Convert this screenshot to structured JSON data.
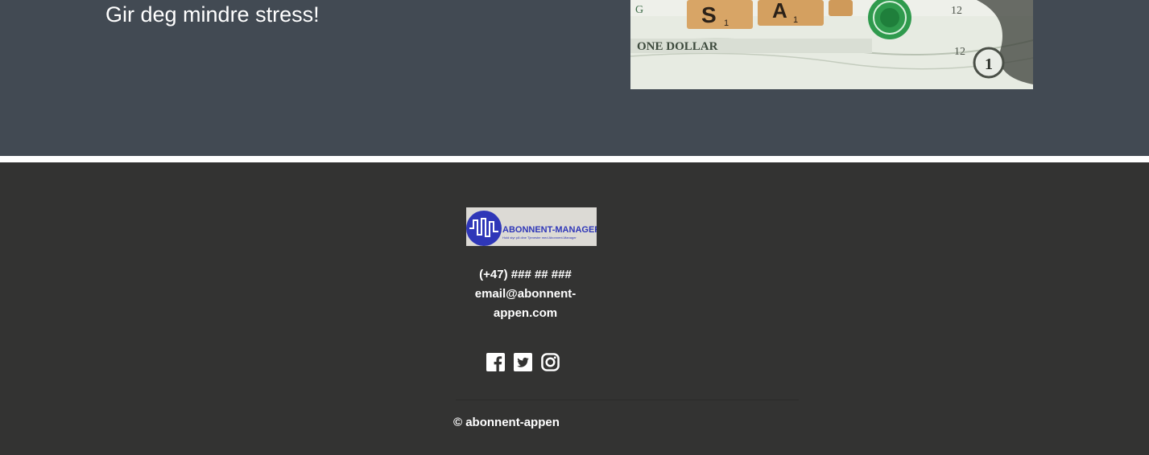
{
  "hero": {
    "tagline": "Gir deg mindre stress!",
    "image": {
      "tiles": [
        "S",
        "A"
      ],
      "tile_subscripts": [
        "1",
        "1"
      ],
      "bill_text": "ONE DOLLAR",
      "bill_numbers": [
        "12",
        "12",
        "1"
      ],
      "bill_letter": "G"
    }
  },
  "footer": {
    "logo": {
      "name": "ABONNENT-MANAGER",
      "tagline": "Hold styr på dine Tjenester med Abonnent-Manager"
    },
    "phone": "(+47) ### ## ###",
    "email_line1": "email@abonnent-",
    "email_line2": "appen.com",
    "socials": [
      {
        "icon": "facebook-icon"
      },
      {
        "icon": "twitter-icon"
      },
      {
        "icon": "instagram-icon"
      }
    ],
    "copyright": "© abonnent-appen"
  },
  "colors": {
    "hero_bg": "#424a53",
    "footer_bg": "#333332",
    "logo_blue": "#2f37b8",
    "text": "#ffffff"
  }
}
